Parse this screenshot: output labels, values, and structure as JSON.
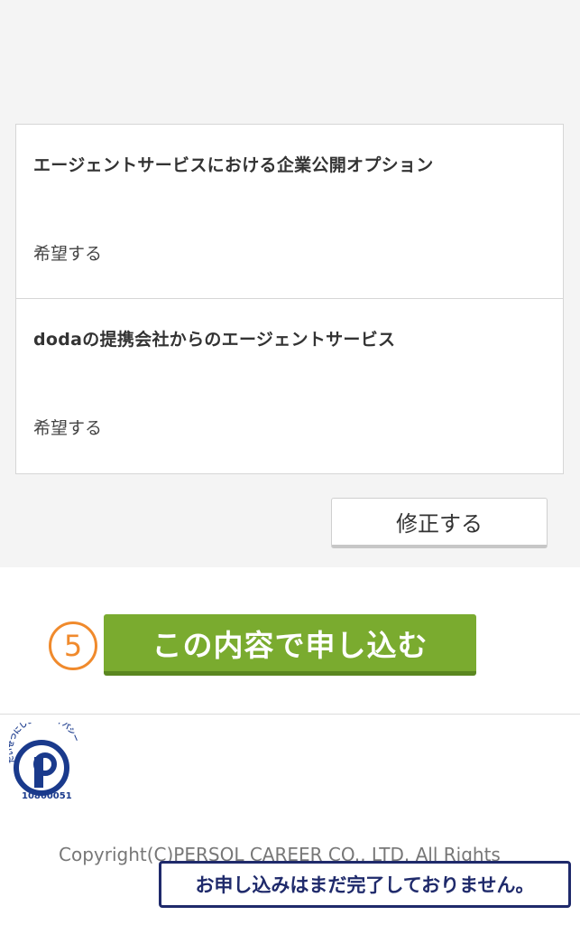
{
  "sections": [
    {
      "title": "エージェントサービスにおける企業公開オプション",
      "value": "希望する"
    },
    {
      "title": "dodaの提携会社からのエージェントサービス",
      "value": "希望する"
    }
  ],
  "edit_button": {
    "label": "修正する"
  },
  "step": {
    "number": "5"
  },
  "submit_button": {
    "label": "この内容で申し込む",
    "color": "#7aab2f"
  },
  "privacy_mark": {
    "icon": "privacy-mark-logo",
    "arc_text": "たいせつにしますプライバシー",
    "number": "10860051"
  },
  "footer": {
    "copyright": "Copyright(C)PERSOL CAREER CO., LTD. All Rights"
  },
  "notice": {
    "text": "お申し込みはまだ完了しておりません。"
  },
  "colors": {
    "accent_green": "#7aab2f",
    "step_orange": "#f08a2c",
    "notice_navy": "#1f2a6b",
    "background_gray": "#f4f4f4"
  }
}
